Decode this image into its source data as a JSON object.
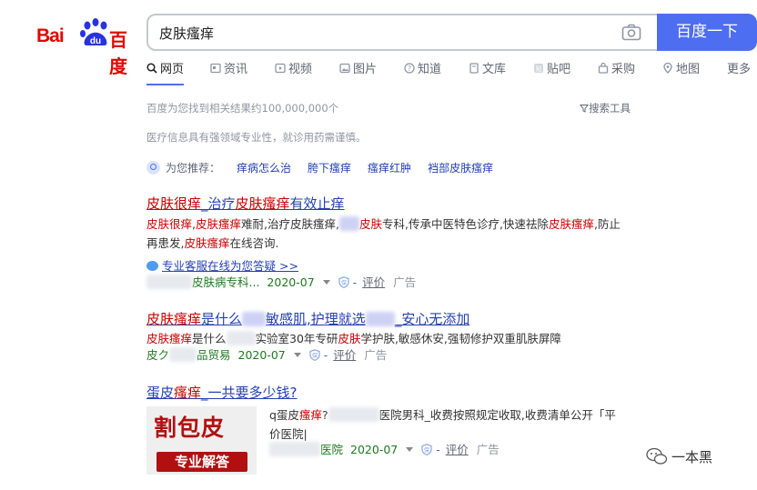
{
  "logo": {
    "text_latin": "Bai",
    "paw_text": "du",
    "text_cn": "百度"
  },
  "search": {
    "query": "皮肤瘙痒",
    "button": "百度一下"
  },
  "tabs": [
    {
      "label": "网页",
      "icon": "search-icon"
    },
    {
      "label": "资讯",
      "icon": "news-icon"
    },
    {
      "label": "视频",
      "icon": "video-icon"
    },
    {
      "label": "图片",
      "icon": "image-icon"
    },
    {
      "label": "知道",
      "icon": "question-icon"
    },
    {
      "label": "文库",
      "icon": "doc-icon"
    },
    {
      "label": "贴吧",
      "icon": "tieba-icon"
    },
    {
      "label": "采购",
      "icon": "bag-icon"
    },
    {
      "label": "地图",
      "icon": "map-icon"
    },
    {
      "label": "更多"
    }
  ],
  "result_meta": "百度为您找到相关结果约100,000,000个",
  "search_tools": "搜索工具",
  "notice": "医疗信息具有强领域专业性，就诊用药需谨慎。",
  "recommend": {
    "label": "为您推荐：",
    "items": [
      "痒病怎么治",
      "胯下瘙痒",
      "瘙痒红肿",
      "裆部皮肤瘙痒"
    ]
  },
  "results": [
    {
      "title_parts": [
        "皮肤很痒",
        "_治疗",
        "皮肤瘙痒",
        "有效止痒"
      ],
      "abs_line1_parts": [
        "皮肤很痒",
        ",",
        "皮肤瘙痒",
        "难耐,治疗皮肤瘙痒,",
        "皮肤",
        "专科,传承中医特色诊疗,快速祛除",
        "皮肤瘙痒",
        ",防止"
      ],
      "abs_line2_parts": [
        "再患发,",
        "皮肤瘙痒",
        "在线咨询."
      ],
      "service_link": "专业客服在线为您答疑 >>",
      "source": "皮肤病专科...",
      "date": "2020-07",
      "eval": "评价",
      "ad": "广告"
    },
    {
      "title_parts": [
        "皮肤瘙痒",
        "是什么",
        "敏感肌,护理就选",
        "_安心无添加"
      ],
      "abs_parts": [
        "皮肤瘙痒",
        "是什么",
        "实验室30年专研",
        "皮肤",
        "学护肤,敏感休安,强韧修护双重肌肤屏障"
      ],
      "source_pre": "皮ク",
      "source": "品贸易",
      "date": "2020-07",
      "eval": "评价",
      "ad": "广告"
    },
    {
      "title_parts": [
        "蛋皮",
        "瘙痒",
        "_一共要多少钱?"
      ],
      "abs_line1_parts": [
        "q蛋皮",
        "瘙痒",
        "?",
        "医院男科_收费按照规定收取,收费清单公开「平"
      ],
      "abs_line2": "价医院|",
      "thumb_line1": "割包皮",
      "thumb_line2": "专业解答",
      "source": "医院",
      "date": "2020-07",
      "eval": "评价",
      "ad": "广告"
    }
  ],
  "watermark": "一本黑",
  "colors": {
    "brand_blue": "#4e6ef2",
    "link_blue": "#2440b3",
    "highlight_red": "#c00",
    "baidu_red": "#e10601",
    "source_green": "#1e7a1e"
  }
}
